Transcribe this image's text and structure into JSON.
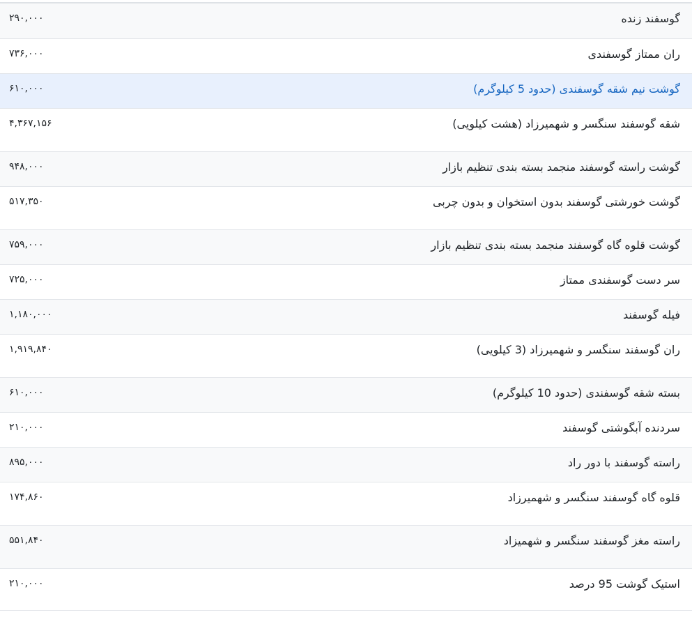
{
  "rows": [
    {
      "name": "گوسفند زنده",
      "price": "۲۹۰,۰۰۰"
    },
    {
      "name": "ران ممتاز گوسفندی",
      "price": "۷۳۶,۰۰۰"
    },
    {
      "name": "گوشت نیم شقه گوسفندی (حدود 5 کیلوگرم)",
      "price": "۶۱۰,۰۰۰"
    },
    {
      "name": "شقه گوسفند سنگسر و شهمیرزاد (هشت کیلویی)",
      "price": "۴,۳۶۷,۱۵۶"
    },
    {
      "name": "گوشت راسته گوسفند منجمد بسته بندی تنظیم بازار",
      "price": "۹۴۸,۰۰۰"
    },
    {
      "name": "گوشت خورشتی گوسفند بدون استخوان و بدون چربی",
      "price": "۵۱۷,۳۵۰"
    },
    {
      "name": "گوشت قلوه گاه گوسفند منجمد بسته بندی تنظیم بازار",
      "price": "۷۵۹,۰۰۰"
    },
    {
      "name": "سر دست گوسفندی ممتاز",
      "price": "۷۲۵,۰۰۰"
    },
    {
      "name": "فیله گوسفند",
      "price": "۱,۱۸۰,۰۰۰"
    },
    {
      "name": "ران گوسفند سنگسر و شهمیرزاد (3 کیلویی)",
      "price": "۱,۹۱۹,۸۴۰"
    },
    {
      "name": "بسته شقه گوسفندی (حدود 10 کیلوگرم)",
      "price": "۶۱۰,۰۰۰"
    },
    {
      "name": "سردنده آبگوشتی گوسفند",
      "price": "۲۱۰,۰۰۰"
    },
    {
      "name": "راسته گوسفند با دور راد",
      "price": "۸۹۵,۰۰۰"
    },
    {
      "name": "قلوه گاه گوسفند سنگسر و شهمیرزاد",
      "price": "۱۷۴,۸۶۰"
    },
    {
      "name": "راسته مغز گوسفند سنگسر و شهمیزاد",
      "price": "۵۵۱,۸۴۰"
    },
    {
      "name": "استیک گوشت 95 درصد",
      "price": "۲۱۰,۰۰۰"
    }
  ],
  "colors": {
    "link": "#1565c0",
    "highlight_row": "#e8f0fd",
    "stripe": "#f8f9fa"
  }
}
